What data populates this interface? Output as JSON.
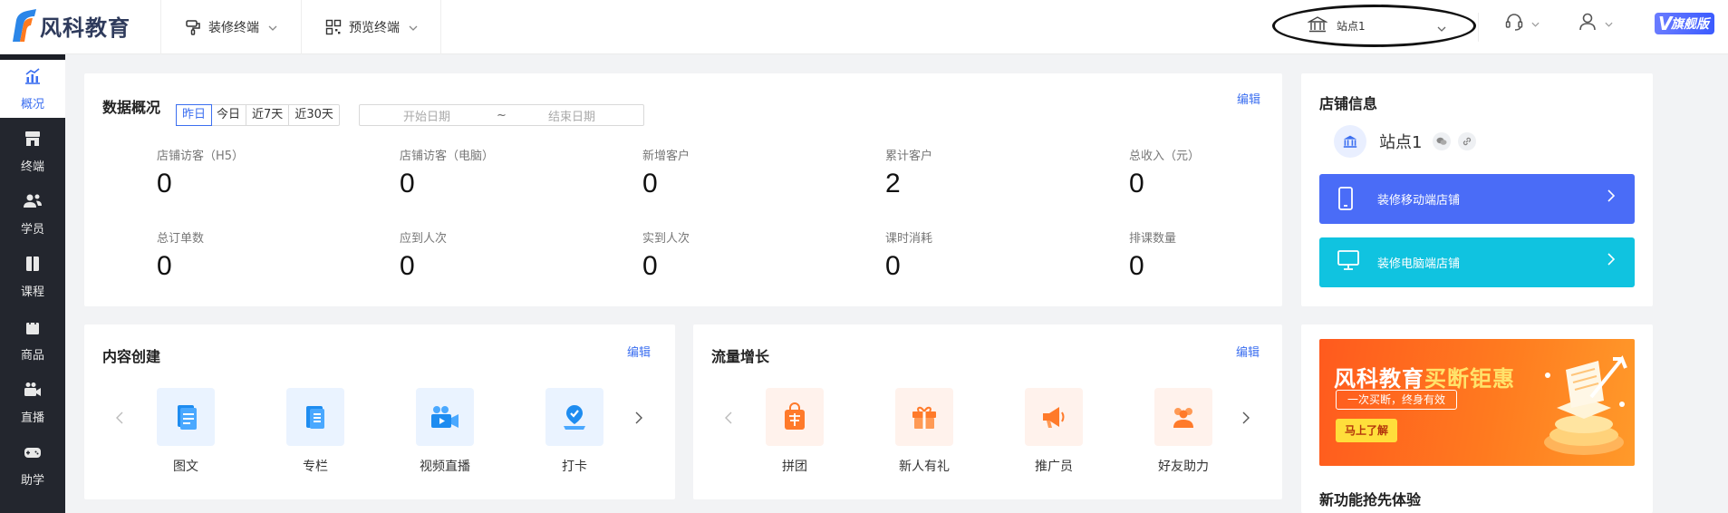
{
  "brand": {
    "name": "风科教育"
  },
  "topnav": [
    {
      "label": "装修终端"
    },
    {
      "label": "预览终端"
    }
  ],
  "site_switch": {
    "label": "站点1"
  },
  "vip": {
    "prefix": "V",
    "label": "旗舰版"
  },
  "sidebar": {
    "items": [
      {
        "label": "概况",
        "icon": "chart-icon",
        "active": true
      },
      {
        "label": "终端",
        "icon": "store-icon"
      },
      {
        "label": "学员",
        "icon": "students-icon"
      },
      {
        "label": "课程",
        "icon": "course-icon"
      },
      {
        "label": "商品",
        "icon": "bag-icon"
      },
      {
        "label": "直播",
        "icon": "video-camera-icon"
      },
      {
        "label": "助学",
        "icon": "gamepad-icon"
      }
    ]
  },
  "overview": {
    "title": "数据概况",
    "edit": "编辑",
    "ranges": [
      "昨日",
      "今日",
      "近7天",
      "近30天"
    ],
    "active_range": "昨日",
    "date_start_placeholder": "开始日期",
    "date_sep": "~",
    "date_end_placeholder": "结束日期",
    "stats": [
      {
        "name": "店铺访客（H5）",
        "value": "0"
      },
      {
        "name": "店铺访客（电脑）",
        "value": "0"
      },
      {
        "name": "新增客户",
        "value": "0"
      },
      {
        "name": "累计客户",
        "value": "2"
      },
      {
        "name": "总收入（元）",
        "value": "0"
      },
      {
        "name": "总订单数",
        "value": "0"
      },
      {
        "name": "应到人次",
        "value": "0"
      },
      {
        "name": "实到人次",
        "value": "0"
      },
      {
        "name": "课时消耗",
        "value": "0"
      },
      {
        "name": "排课数量",
        "value": "0"
      }
    ]
  },
  "shop": {
    "title": "店铺信息",
    "name": "站点1",
    "btn_mobile": "装修移动端店铺",
    "btn_pc": "装修电脑端店铺",
    "colors": {
      "mobile": "#4a6cf7",
      "pc": "#10c3e0"
    }
  },
  "content": {
    "title": "内容创建",
    "edit": "编辑",
    "tiles": [
      {
        "label": "图文",
        "icon": "article-icon"
      },
      {
        "label": "专栏",
        "icon": "column-icon"
      },
      {
        "label": "视频直播",
        "icon": "video-live-icon"
      },
      {
        "label": "打卡",
        "icon": "checkin-icon"
      }
    ]
  },
  "growth": {
    "title": "流量增长",
    "edit": "编辑",
    "tiles": [
      {
        "label": "拼团",
        "icon": "group-buy-icon"
      },
      {
        "label": "新人有礼",
        "icon": "gift-icon"
      },
      {
        "label": "推广员",
        "icon": "megaphone-icon"
      },
      {
        "label": "好友助力",
        "icon": "friends-icon"
      }
    ]
  },
  "promo": {
    "headline_a": "风科教育",
    "headline_b": "买断钜惠",
    "sub": "一次买断，终身有效",
    "cta": "马上了解",
    "new_title": "新功能抢先体验"
  }
}
